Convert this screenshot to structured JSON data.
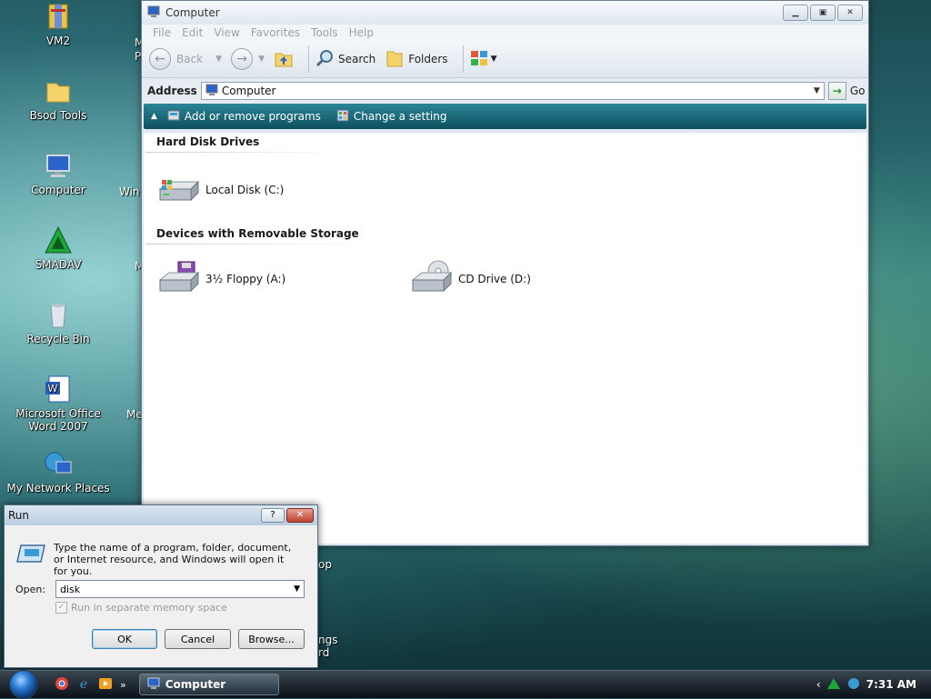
{
  "desktop": {
    "icons": [
      {
        "label": "VM2",
        "icon": "archive-folder-icon"
      },
      {
        "label": "Bsod Tools",
        "icon": "folder-icon"
      },
      {
        "label": "Computer",
        "icon": "computer-icon"
      },
      {
        "label": "SMADAV",
        "icon": "smadav-icon"
      },
      {
        "label": "Recycle Bin",
        "icon": "recycle-bin-icon"
      },
      {
        "label": "Microsoft Office Word 2007",
        "icon": "word-icon"
      },
      {
        "label": "My Network Places",
        "icon": "network-places-icon"
      }
    ],
    "partial_labels": [
      "M",
      "P",
      "Win",
      "M",
      "Me",
      "op",
      "ngs",
      "rd"
    ]
  },
  "explorer": {
    "title": "Computer",
    "menu": [
      "File",
      "Edit",
      "View",
      "Favorites",
      "Tools",
      "Help"
    ],
    "toolbar": {
      "back": "Back",
      "search": "Search",
      "folders": "Folders"
    },
    "address": {
      "label": "Address",
      "value": "Computer",
      "go": "Go"
    },
    "tasks": [
      "Add or remove programs",
      "Change a setting"
    ],
    "groups": [
      {
        "title": "Hard Disk Drives",
        "items": [
          {
            "label": "Local Disk (C:)",
            "icon": "hard-disk-icon"
          }
        ]
      },
      {
        "title": "Devices with Removable Storage",
        "items": [
          {
            "label": "3½ Floppy (A:)",
            "icon": "floppy-drive-icon"
          },
          {
            "label": "CD Drive (D:)",
            "icon": "cd-drive-icon"
          }
        ]
      }
    ]
  },
  "run_dialog": {
    "title": "Run",
    "description": "Type the name of a program, folder, document, or Internet resource, and Windows will open it for you.",
    "open_label": "Open:",
    "open_value": "disk",
    "checkbox_label": "Run in separate memory space",
    "buttons": {
      "ok": "OK",
      "cancel": "Cancel",
      "browse": "Browse..."
    }
  },
  "taskbar": {
    "window_button": "Computer",
    "clock": "7:31 AM"
  }
}
